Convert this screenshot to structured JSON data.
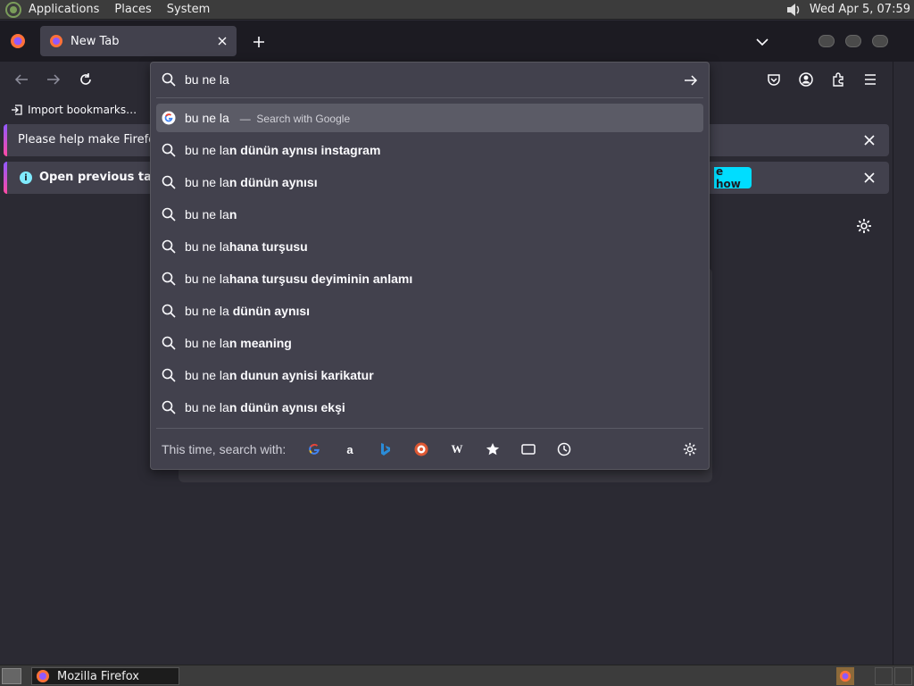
{
  "top_panel": {
    "menus": [
      "Applications",
      "Places",
      "System"
    ],
    "clock": "Wed Apr  5, 07:59"
  },
  "tab": {
    "title": "New Tab"
  },
  "bookmarks": {
    "import_label": "Import bookmarks…"
  },
  "notifications": {
    "first": "Please help make Firefox",
    "second": "Open previous tabs",
    "second_button": "e how"
  },
  "urlbar": {
    "value": "bu ne la",
    "first_result": {
      "text": "bu ne la",
      "separator": "—",
      "action": "Search with Google"
    },
    "suggestions": [
      {
        "typed": "bu ne la",
        "completion": "n dünün aynısı instagram"
      },
      {
        "typed": "bu ne la",
        "completion": "n dünün aynısı"
      },
      {
        "typed": "bu ne la",
        "completion": "n"
      },
      {
        "typed": "bu ne la",
        "completion": "hana turşusu"
      },
      {
        "typed": "bu ne la",
        "completion": "hana turşusu deyiminin anlamı"
      },
      {
        "typed": "bu ne la",
        "completion": " dünün aynısı"
      },
      {
        "typed": "bu ne la",
        "completion": "n meaning"
      },
      {
        "typed": "bu ne la",
        "completion": "n dunun aynisi karikatur"
      },
      {
        "typed": "bu ne la",
        "completion": "n dünün aynısı ekşi"
      }
    ],
    "footer_label": "This time, search with:",
    "engines": [
      "google",
      "amazon",
      "bing",
      "duckduckgo",
      "wikipedia",
      "bookmarks",
      "tabs",
      "history"
    ]
  },
  "taskbar": {
    "window_title": "Mozilla Firefox"
  },
  "colors": {
    "accent_cyan": "#00ddff",
    "selected_row": "#5b5b66",
    "popup_bg": "#42414d",
    "toolbar_bg": "#2b2a33"
  }
}
